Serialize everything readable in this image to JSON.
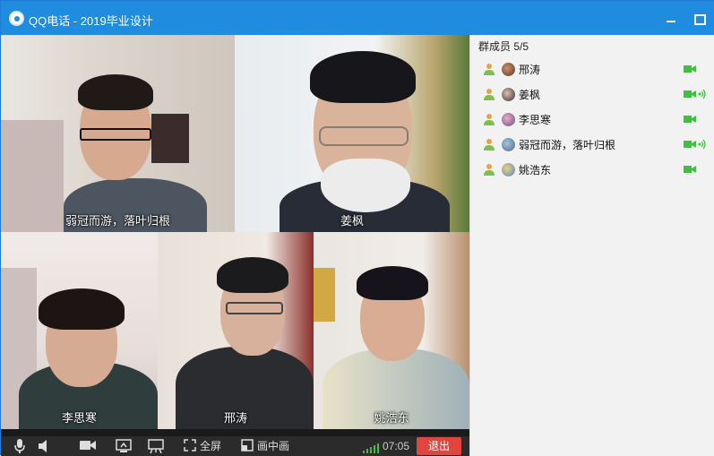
{
  "window": {
    "title": "QQ电话 - 2019毕业设计"
  },
  "participants": [
    {
      "name": "弱冠而游，落叶归根"
    },
    {
      "name": "姜枫"
    },
    {
      "name": "李思寒"
    },
    {
      "name": "邢涛"
    },
    {
      "name": "姚浩东"
    }
  ],
  "toolbar": {
    "mic_icon": "microphone-icon",
    "speaker_icon": "speaker-icon",
    "camera_icon": "camera-icon",
    "share_icon": "screen-share-icon",
    "whiteboard_icon": "presentation-icon",
    "fullscreen_label": "全屏",
    "pip_label": "画中画",
    "call_time": "07:05",
    "exit_label": "退出"
  },
  "members_panel": {
    "header": "群成员 5/5",
    "members": [
      {
        "name": "邢涛",
        "speaking": false
      },
      {
        "name": "姜枫",
        "speaking": true
      },
      {
        "name": "李思寒",
        "speaking": false
      },
      {
        "name": "弱冠而游，落叶归根",
        "speaking": true
      },
      {
        "name": "姚浩东",
        "speaking": false
      }
    ]
  },
  "colors": {
    "titlebar": "#1f8ce0",
    "exit_button": "#e2453d",
    "status_green": "#3cc33c"
  }
}
